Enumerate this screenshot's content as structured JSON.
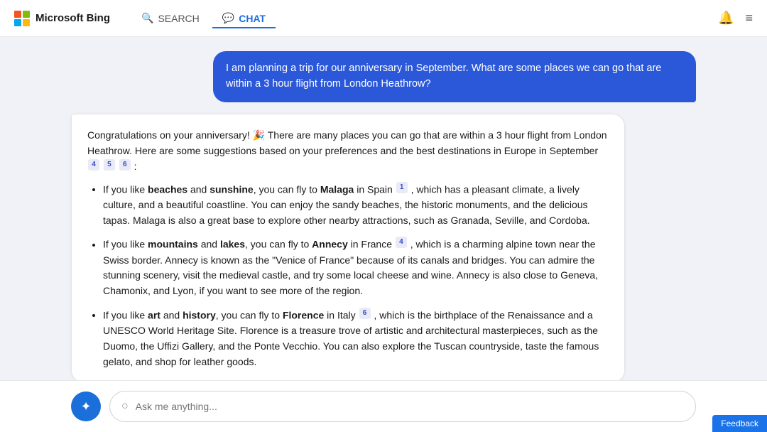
{
  "brand": {
    "name": "Microsoft Bing"
  },
  "nav": {
    "search_label": "SEARCH",
    "chat_label": "CHAT"
  },
  "messages": {
    "user": "I am planning a trip for our anniversary in September. What are some places we can go that are within a 3 hour flight from London Heathrow?",
    "bot_intro": "Congratulations on your anniversary! 🎉 There are many places you can go that are within a 3 hour flight from London Heathrow. Here are some suggestions based on your preferences and the best destinations in Europe in September",
    "bot_refs_intro": [
      "4",
      "5",
      "6"
    ],
    "bullets": [
      {
        "text_parts": [
          "If you like ",
          "beaches",
          " and ",
          "sunshine",
          ", you can fly to ",
          "Malaga",
          " in Spain"
        ],
        "ref": "1",
        "rest": ", which has a pleasant climate, a lively culture, and a beautiful coastline. You can enjoy the sandy beaches, the historic monuments, and the delicious tapas. Malaga is also a great base to explore other nearby attractions, such as Granada, Seville, and Cordoba."
      },
      {
        "text_parts": [
          "If you like ",
          "mountains",
          " and ",
          "lakes",
          ", you can fly to ",
          "Annecy",
          " in France"
        ],
        "ref": "4",
        "rest": ", which is a charming alpine town near the Swiss border. Annecy is known as the \"Venice of France\" because of its canals and bridges. You can admire the stunning scenery, visit the medieval castle, and try some local cheese and wine. Annecy is also close to Geneva, Chamonix, and Lyon, if you want to see more of the region."
      },
      {
        "text_parts": [
          "If you like ",
          "art",
          " and ",
          "history",
          ", you can fly to ",
          "Florence",
          " in Italy"
        ],
        "ref": "6",
        "rest": ", which is the birthplace of the Renaissance and a UNESCO World Heritage Site. Florence is a treasure trove of artistic and architectural masterpieces, such as the Duomo, the Uffizi Gallery, and the Ponte Vecchio. You can also explore the Tuscan countryside, taste the famous gelato, and shop for leather goods."
      }
    ]
  },
  "input": {
    "placeholder": "Ask me anything..."
  },
  "feedback": {
    "label": "Feedback"
  }
}
